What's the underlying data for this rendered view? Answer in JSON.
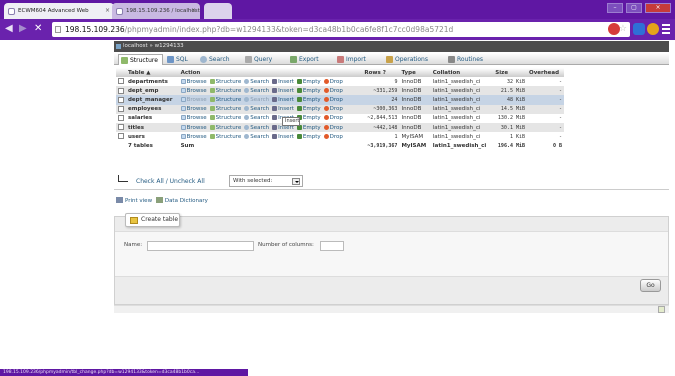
{
  "browser": {
    "tabs": [
      {
        "label": "ECWM604 Advanced Web",
        "close": "×"
      },
      {
        "label": "198.15.109.236 / localhost",
        "close": "×"
      },
      {
        "label": "",
        "close": ""
      }
    ],
    "window_buttons": [
      "–",
      "▢",
      "×"
    ],
    "url_host": "198.15.109.236",
    "url_path": "/phpmyadmin/index.php?db=w1294133&token=d3ca48b1b0ca6fe8f1c7cc0d98a5721d",
    "status_url": "198.15.109.236/phpmyadmin/tbl_change.php?db=w1294133&token=d3ca48b1b0ca..."
  },
  "breadcrumb": {
    "server": "localhost",
    "separator": "»",
    "database": "w1294133"
  },
  "tabs": [
    {
      "label": "Structure",
      "icon": "structure-icon",
      "color": "#8fb96a"
    },
    {
      "label": "SQL",
      "icon": "sql-icon",
      "color": "#6d95c6"
    },
    {
      "label": "Search",
      "icon": "search-icon",
      "color": "#9fb7cf"
    },
    {
      "label": "Query",
      "icon": "query-icon",
      "color": "#aaa"
    },
    {
      "label": "Export",
      "icon": "export-icon",
      "color": "#7aa86a"
    },
    {
      "label": "Import",
      "icon": "import-icon",
      "color": "#c97a7a"
    },
    {
      "label": "Operations",
      "icon": "operations-icon",
      "color": "#c9a24a"
    },
    {
      "label": "Routines",
      "icon": "routines-icon",
      "color": "#888"
    }
  ],
  "table_headers": {
    "table": "Table",
    "sort_arrow": "▲",
    "action": "Action",
    "rows": "Rows",
    "rows_help": "?",
    "type": "Type",
    "collation": "Collation",
    "size": "Size",
    "overhead": "Overhead"
  },
  "actions": {
    "browse": "Browse",
    "structure": "Structure",
    "search": "Search",
    "insert": "Insert",
    "empty": "Empty",
    "drop": "Drop"
  },
  "rows": [
    {
      "name": "departments",
      "rows": "9",
      "type": "InnoDB",
      "collation": "latin1_swedish_ci",
      "size": "32 KiB",
      "overhead": "-",
      "style": "odd"
    },
    {
      "name": "dept_emp",
      "rows": "~331,259",
      "type": "InnoDB",
      "collation": "latin1_swedish_ci",
      "size": "21.5 MiB",
      "overhead": "-",
      "style": "even"
    },
    {
      "name": "dept_manager",
      "rows": "24",
      "type": "InnoDB",
      "collation": "latin1_swedish_ci",
      "size": "48 KiB",
      "overhead": "-",
      "style": "marked"
    },
    {
      "name": "employees",
      "rows": "~300,363",
      "type": "InnoDB",
      "collation": "latin1_swedish_ci",
      "size": "14.5 MiB",
      "overhead": "-",
      "style": "even"
    },
    {
      "name": "salaries",
      "rows": "~2,844,513",
      "type": "InnoDB",
      "collation": "latin1_swedish_ci",
      "size": "130.2 MiB",
      "overhead": "-",
      "style": "odd"
    },
    {
      "name": "titles",
      "rows": "~442,148",
      "type": "InnoDB",
      "collation": "latin1_swedish_ci",
      "size": "30.1 MiB",
      "overhead": "-",
      "style": "even"
    },
    {
      "name": "users",
      "rows": "1",
      "type": "MyISAM",
      "collation": "latin1_swedish_ci",
      "size": "1 KiB",
      "overhead": "-",
      "style": "odd"
    }
  ],
  "summary": {
    "label": "7 tables",
    "sum": "Sum",
    "rows": "~3,919,367",
    "type": "MyISAM",
    "collation": "latin1_swedish_ci",
    "size": "196.4 MiB",
    "overhead": "0 B"
  },
  "tooltip": "Insert",
  "check_all": "Check All / Uncheck All",
  "with_selected": "With selected:",
  "print_view": "Print view",
  "data_dictionary": "Data Dictionary",
  "create_table": {
    "legend": "Create table",
    "name_label": "Name:",
    "columns_label": "Number of columns:",
    "go": "Go"
  }
}
